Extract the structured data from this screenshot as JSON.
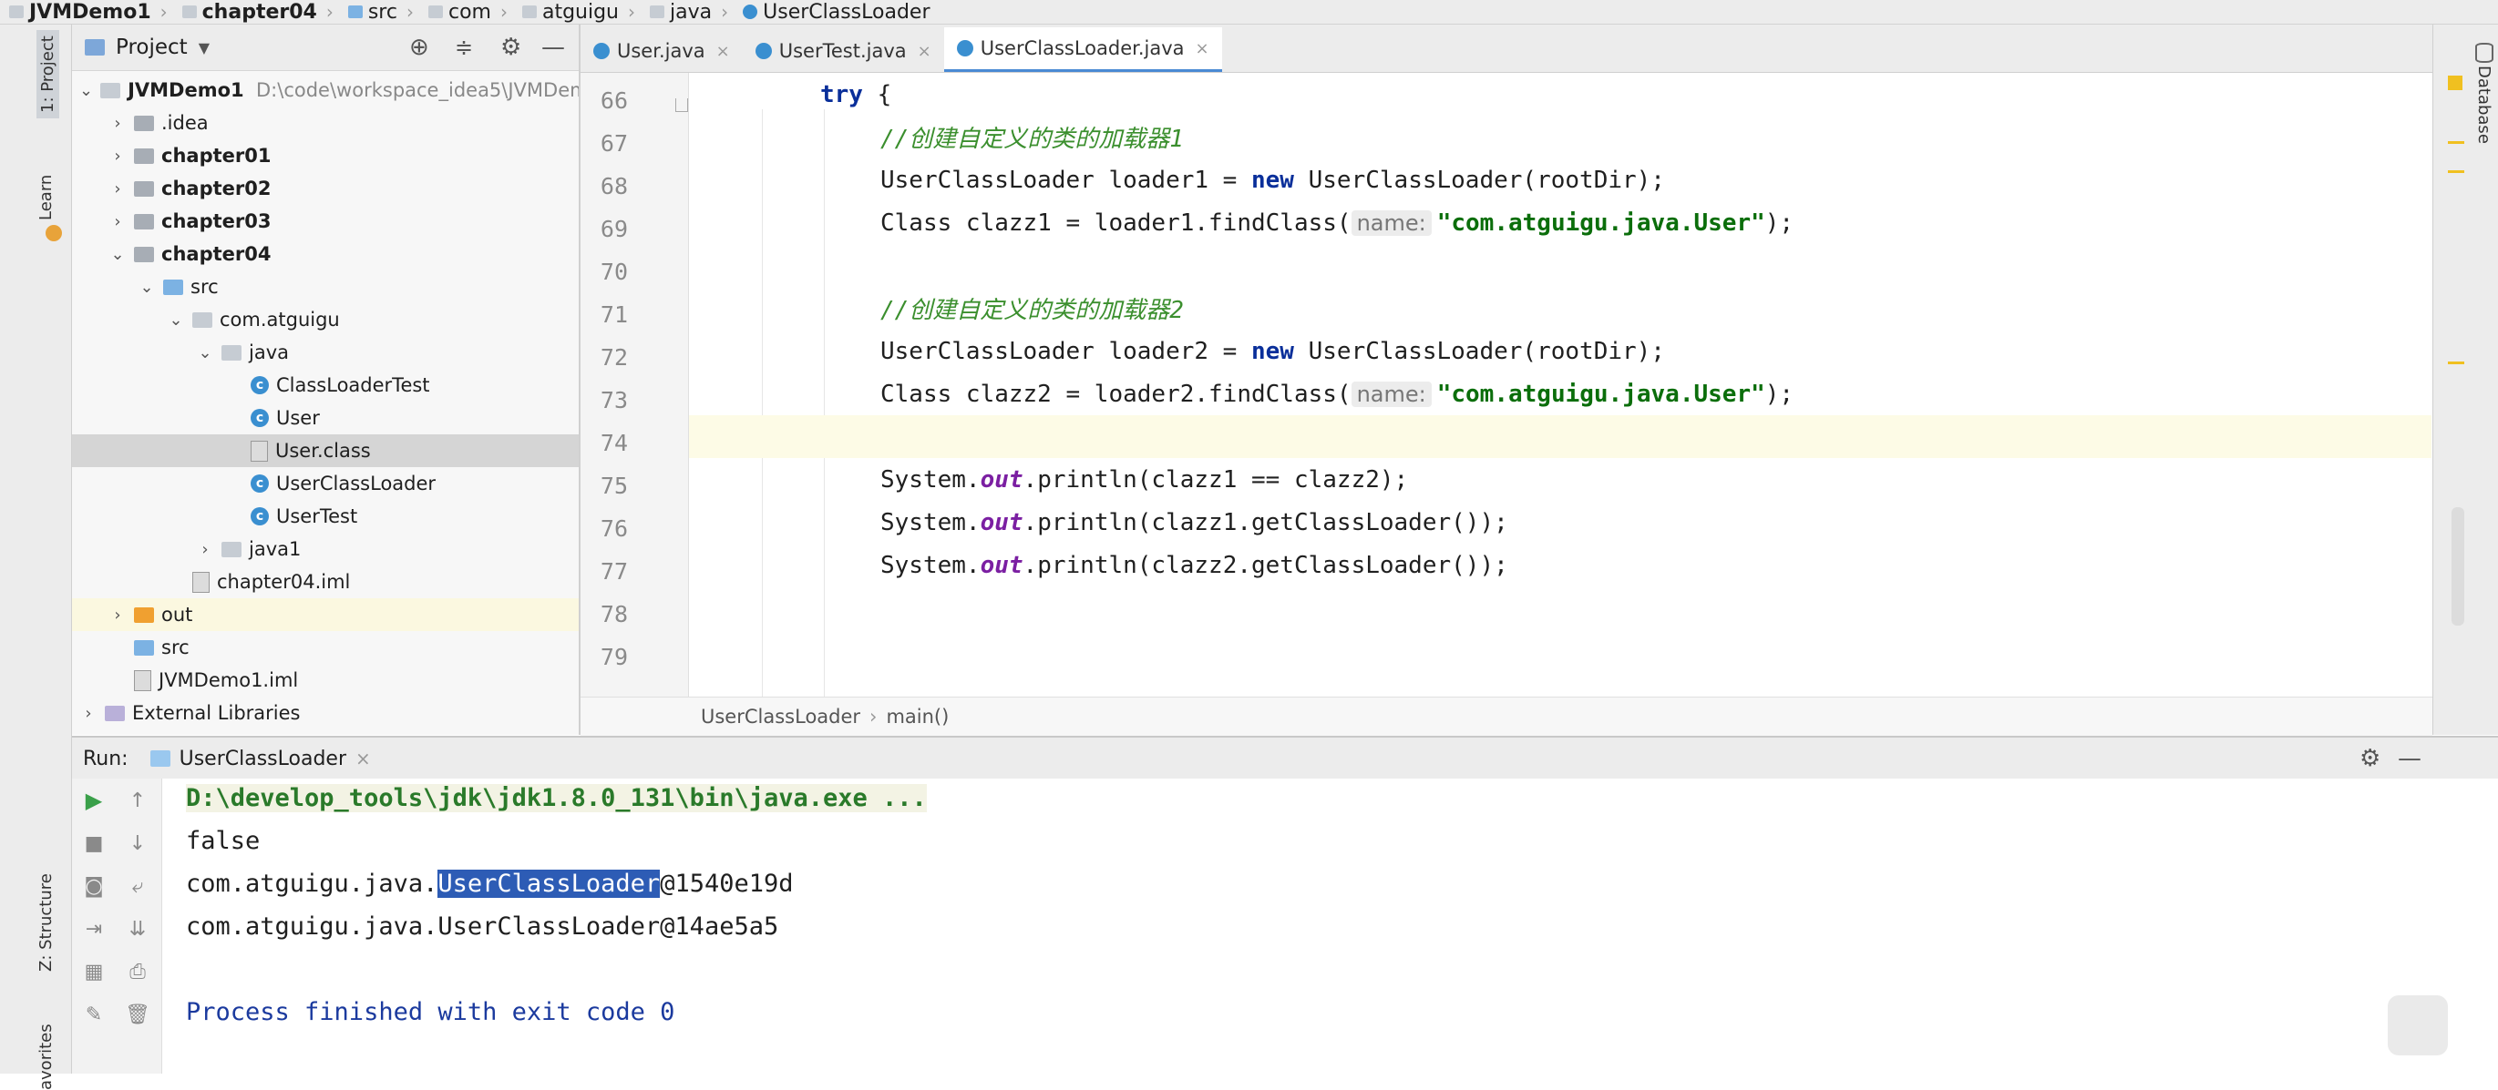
{
  "breadcrumb": [
    "JVMDemo1",
    "chapter04",
    "src",
    "com",
    "atguigu",
    "java",
    "UserClassLoader"
  ],
  "left_strip": {
    "project_tab": "1: Project",
    "learn_tab": "Learn",
    "structure_tab": "Z: Structure",
    "favorites_tab": "avorites"
  },
  "right_strip": {
    "database_tab": "Database"
  },
  "project": {
    "header": "Project",
    "tree": [
      {
        "label": "JVMDemo1",
        "extra": "D:\\code\\workspace_idea5\\JVMDem"
      },
      {
        "label": ".idea"
      },
      {
        "label": "chapter01"
      },
      {
        "label": "chapter02"
      },
      {
        "label": "chapter03"
      },
      {
        "label": "chapter04"
      },
      {
        "label": "src"
      },
      {
        "label": "com.atguigu"
      },
      {
        "label": "java"
      },
      {
        "label": "ClassLoaderTest"
      },
      {
        "label": "User"
      },
      {
        "label": "User.class"
      },
      {
        "label": "UserClassLoader"
      },
      {
        "label": "UserTest"
      },
      {
        "label": "java1"
      },
      {
        "label": "chapter04.iml"
      },
      {
        "label": "out"
      },
      {
        "label": "src"
      },
      {
        "label": "JVMDemo1.iml"
      },
      {
        "label": "External Libraries"
      }
    ]
  },
  "tabs": [
    {
      "label": "User.java",
      "close": "×"
    },
    {
      "label": "UserTest.java",
      "close": "×"
    },
    {
      "label": "UserClassLoader.java",
      "close": "×"
    }
  ],
  "editor": {
    "lines": [
      "66",
      "67",
      "68",
      "69",
      "70",
      "71",
      "72",
      "73",
      "74",
      "75",
      "76",
      "77",
      "78",
      "79"
    ],
    "code": {
      "l66_kw": "try",
      "l66_rest": " {",
      "l67": "//创建自定义的类的加载器1",
      "l68_a": "UserClassLoader loader1 = ",
      "l68_kw": "new",
      "l68_b": " UserClassLoader(rootDir);",
      "l69_a": "Class clazz1 = loader1.findClass(",
      "l69_hint": "name:",
      "l69_str": "\"com.atguigu.java.User\"",
      "l69_b": ");",
      "l71": "//创建自定义的类的加载器2",
      "l72_a": "UserClassLoader loader2 = ",
      "l72_kw": "new",
      "l72_b": " UserClassLoader(rootDir);",
      "l73_a": "Class clazz2 = loader2.findClass(",
      "l73_hint": "name:",
      "l73_str": "\"com.atguigu.java.User\"",
      "l73_b": ");",
      "l75_a": "System.",
      "l75_f": "out",
      "l75_b": ".println(clazz1 == clazz2);",
      "l76_a": "System.",
      "l76_f": "out",
      "l76_b": ".println(clazz1.getClassLoader());",
      "l77_a": "System.",
      "l77_f": "out",
      "l77_b": ".println(clazz2.getClassLoader());"
    },
    "breadcrumb_class": "UserClassLoader",
    "breadcrumb_sep": "›",
    "breadcrumb_method": "main()"
  },
  "run": {
    "label": "Run:",
    "tab": "UserClassLoader",
    "tab_close": "×",
    "console": {
      "cmd": "D:\\develop_tools\\jdk\\jdk1.8.0_131\\bin\\java.exe ...",
      "out1": "false",
      "out2_a": "com.atguigu.java.",
      "out2_sel": "UserClassLoader",
      "out2_b": "@1540e19d",
      "out3": "com.atguigu.java.UserClassLoader@14ae5a5",
      "finish": "Process finished with exit code 0"
    }
  },
  "colors": {
    "keyword": "#0a2f9a",
    "comment": "#3b8f2e",
    "string": "#0b6e0b",
    "selection": "#2d5cb5"
  }
}
